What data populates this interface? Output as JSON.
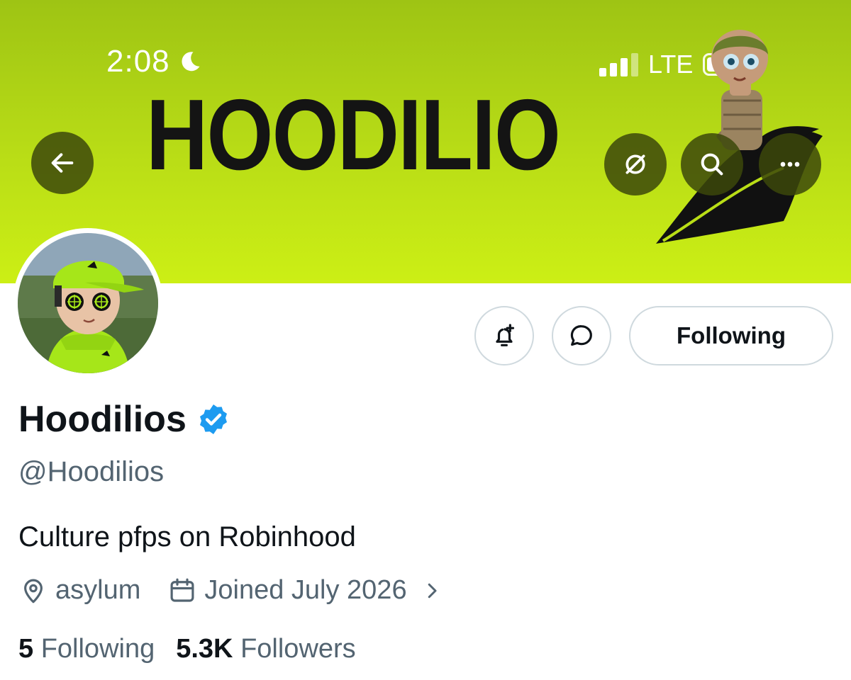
{
  "status_bar": {
    "time": "2:08",
    "network": "LTE"
  },
  "banner": {
    "brand_text": "HOODILIO"
  },
  "header_buttons": {
    "back_icon": "arrow-left-icon",
    "hide_icon": "eye-slash-icon",
    "search_icon": "search-icon",
    "more_icon": "ellipsis-icon"
  },
  "profile": {
    "display_name": "Hoodilios",
    "handle": "@Hoodilios",
    "bio": "Culture pfps on Robinhood",
    "location": "asylum",
    "joined": "Joined July 2026",
    "following_count": "5",
    "following_label": "Following",
    "followers_count": "5.3K",
    "followers_label": "Followers"
  },
  "actions": {
    "following_button_label": "Following"
  },
  "colors": {
    "banner_top": "#9ec414",
    "banner_bottom": "#ccef15",
    "verified_blue": "#1d9bf0",
    "text_primary": "#0f1419",
    "text_secondary": "#536471",
    "button_border": "#cfd9de"
  }
}
